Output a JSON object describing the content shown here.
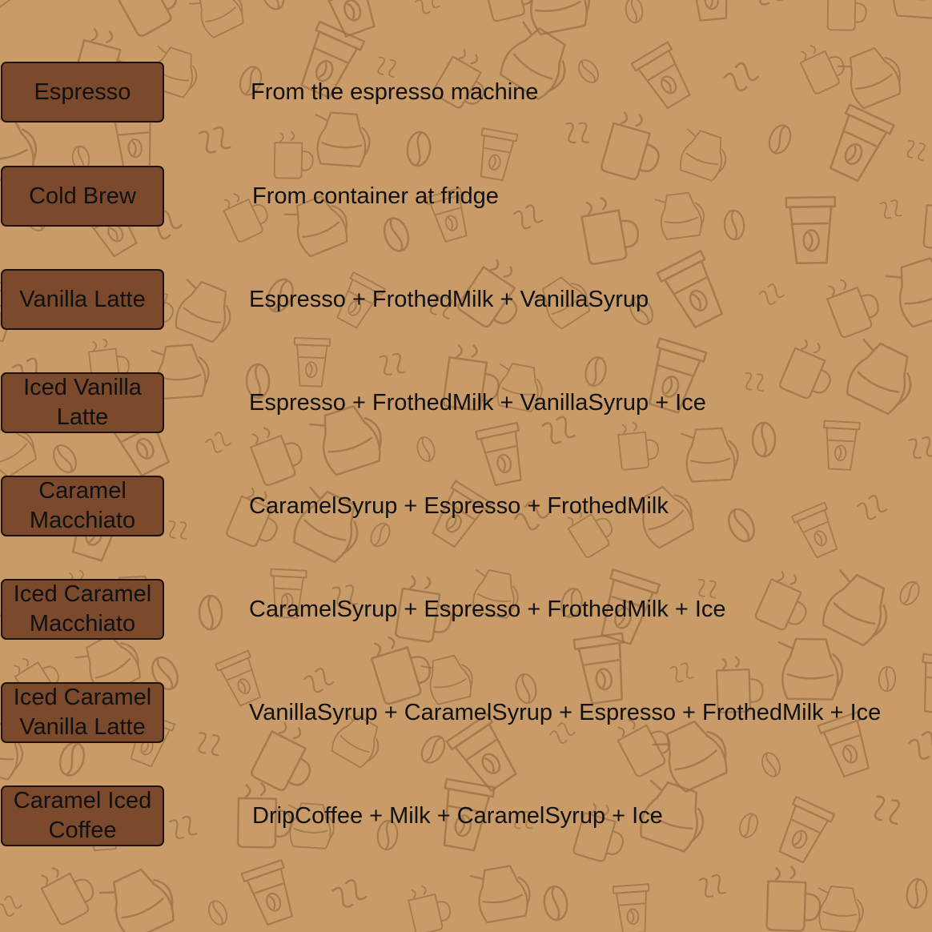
{
  "colors": {
    "background": "#c89b68",
    "doodle": "#9a6f45",
    "button_fill": "#7b4a2c",
    "button_border": "#1e120a",
    "text": "#111111"
  },
  "recipes": [
    {
      "drink": "Espresso",
      "ingredients": "From the espresso machine"
    },
    {
      "drink": "Cold Brew",
      "ingredients": "From container at fridge"
    },
    {
      "drink": "Vanilla Latte",
      "ingredients": "Espresso + FrothedMilk + VanillaSyrup"
    },
    {
      "drink": "Iced Vanilla Latte",
      "ingredients": "Espresso + FrothedMilk + VanillaSyrup + Ice"
    },
    {
      "drink": "Caramel Macchiato",
      "ingredients": "CaramelSyrup + Espresso + FrothedMilk"
    },
    {
      "drink": "Iced Caramel Macchiato",
      "ingredients": "CaramelSyrup + Espresso + FrothedMilk + Ice"
    },
    {
      "drink": "Iced Caramel Vanilla Latte",
      "ingredients": "VanillaSyrup + CaramelSyrup + Espresso + FrothedMilk + Ice"
    },
    {
      "drink": "Caramel Iced Coffee",
      "ingredients": "DripCoffee + Milk + CaramelSyrup + Ice"
    }
  ],
  "background_icons": [
    "coffee-cup-icon",
    "coffee-bean-icon",
    "coffee-pot-icon",
    "mug-icon",
    "steam-icon"
  ]
}
